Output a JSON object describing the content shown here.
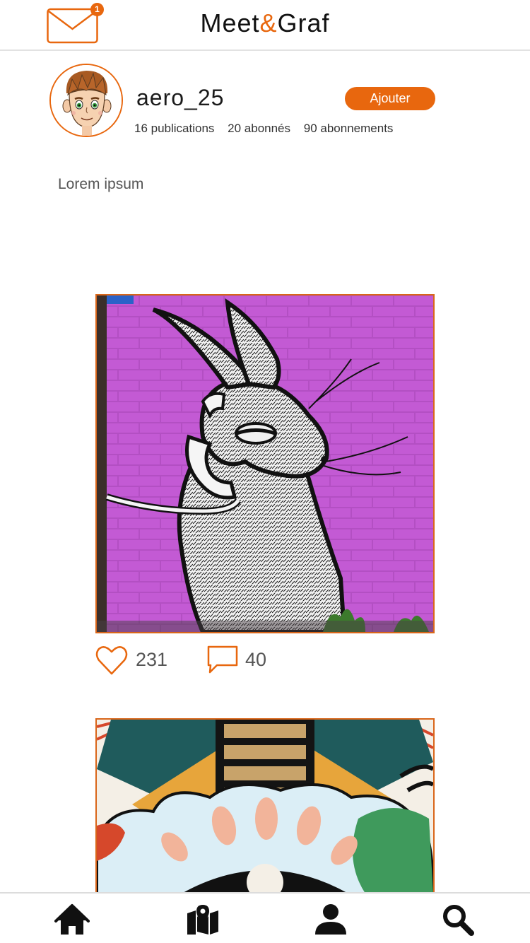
{
  "header": {
    "brand_part1": "Meet",
    "brand_amp": "&",
    "brand_part2": "Graf",
    "unread_count": "1"
  },
  "profile": {
    "username": "aero_25",
    "add_label": "Ajouter",
    "publications": "16 publications",
    "followers": "20 abonnés",
    "following": "90 abonnements",
    "bio": "Lorem ipsum"
  },
  "posts": [
    {
      "likes": "231",
      "comments": "40"
    }
  ],
  "nav": {
    "items": [
      "home-icon",
      "map-icon",
      "profile-icon",
      "search-icon"
    ]
  },
  "colors": {
    "accent": "#e8670e",
    "wall": "#b04cc0"
  }
}
